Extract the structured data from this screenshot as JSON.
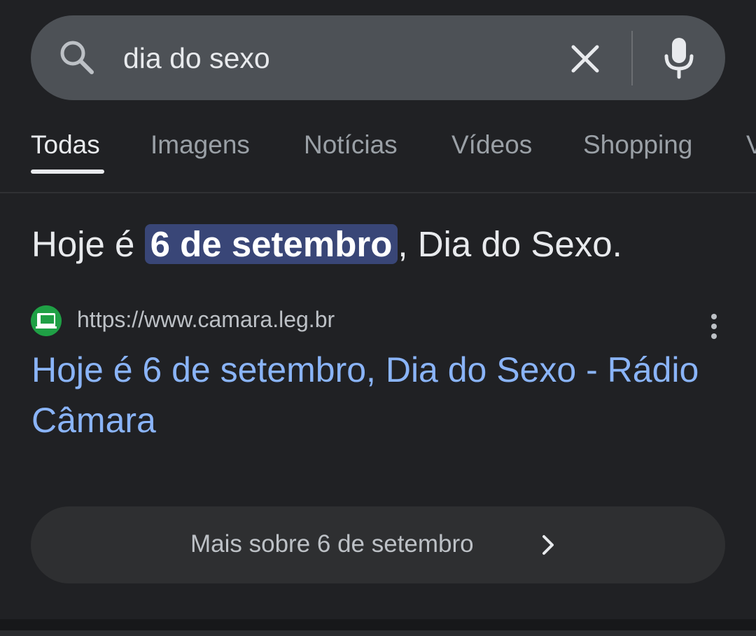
{
  "search": {
    "query": "dia do sexo"
  },
  "tabs": [
    {
      "label": "Todas",
      "active": true
    },
    {
      "label": "Imagens",
      "active": false
    },
    {
      "label": "Notícias",
      "active": false
    },
    {
      "label": "Vídeos",
      "active": false
    },
    {
      "label": "Shopping",
      "active": false
    },
    {
      "label": "V",
      "active": false
    }
  ],
  "answer": {
    "prefix": "Hoje é ",
    "highlight": "6 de setembro",
    "suffix": ", Dia do Sexo."
  },
  "result": {
    "url": "https://www.camara.leg.br",
    "title": "Hoje é 6 de setembro, Dia do Sexo - Rádio Câmara"
  },
  "more": {
    "label": "Mais sobre 6 de setembro"
  },
  "icons": {
    "search": "search-icon",
    "clear": "close-icon",
    "mic": "microphone-icon",
    "more": "more-vert-icon",
    "chevron": "chevron-right-icon"
  },
  "colors": {
    "background": "#202124",
    "searchbar": "#4d5156",
    "link": "#8ab4f8",
    "highlight": "#394677",
    "favicon": "#1fa045"
  }
}
